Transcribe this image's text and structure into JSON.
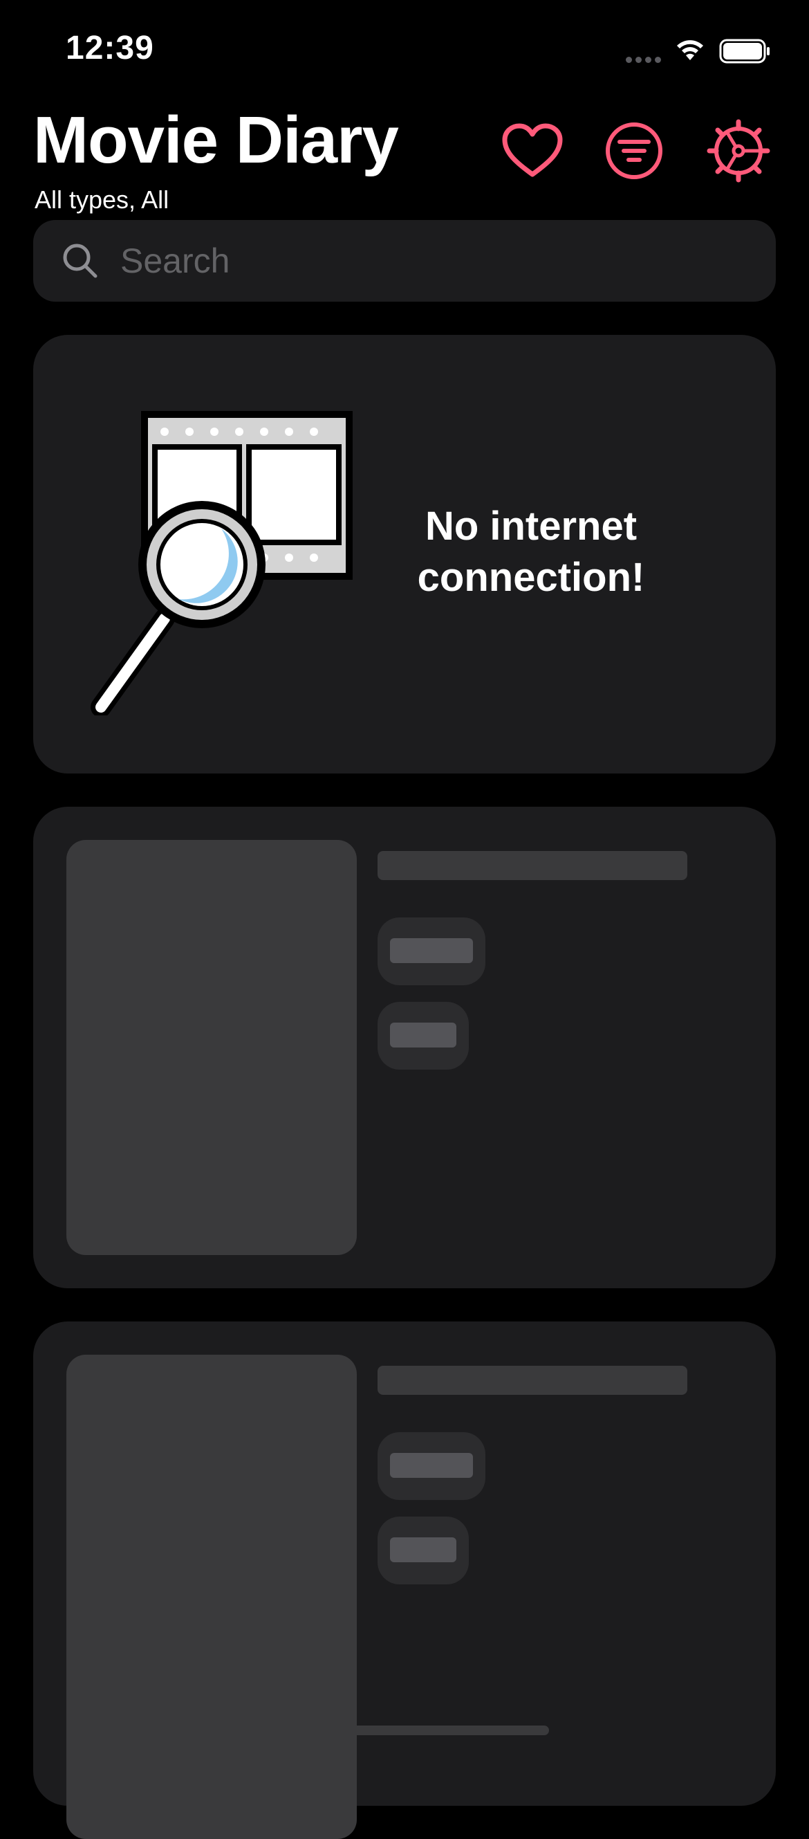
{
  "status_bar": {
    "time": "12:39",
    "icons": [
      "cellular-signal-icon",
      "wifi-icon",
      "battery-icon"
    ]
  },
  "header": {
    "title": "Movie Diary",
    "subtitle": "All types, All",
    "buttons": {
      "favorites_icon": "heart-icon",
      "filter_icon": "filter-icon",
      "settings_icon": "gear-icon"
    }
  },
  "search": {
    "placeholder": "Search",
    "value": ""
  },
  "error_card": {
    "illustration_icon": "magnifier-film-icon",
    "message": "No internet connection!"
  },
  "skeleton_cards": [
    {
      "state": "loading"
    },
    {
      "state": "loading"
    }
  ],
  "colors": {
    "accent": "#ff5a7a",
    "background": "#000000",
    "card": "#1c1c1e",
    "skeleton": "#3a3a3c",
    "placeholder": "#636366"
  }
}
